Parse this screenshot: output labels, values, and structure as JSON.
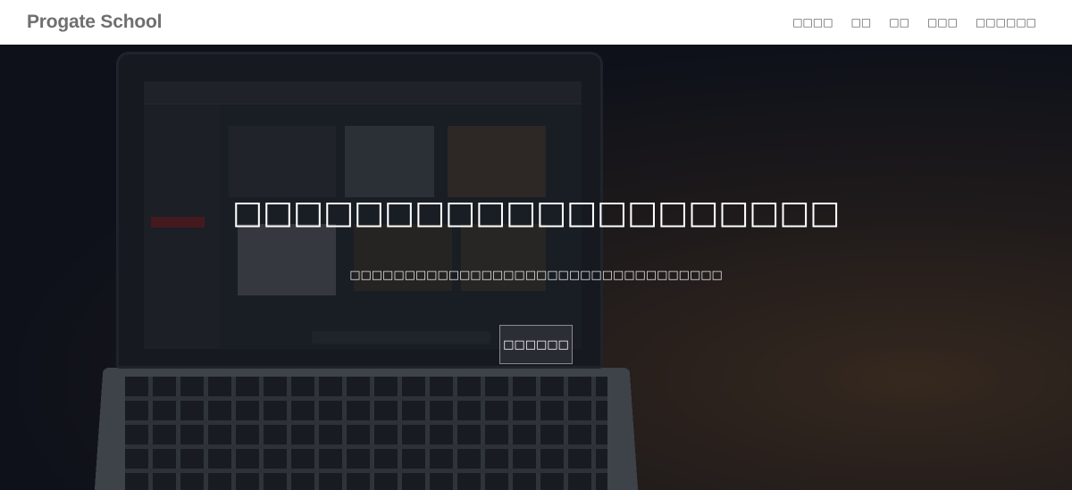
{
  "header": {
    "logo": "Progate School",
    "nav": [
      "□□□□",
      "□□",
      "□□",
      "□□□",
      "□□□□□□"
    ]
  },
  "hero": {
    "title": "□□□□□□□□□□□□□□□□□□□□",
    "subtitle": "□□□□□□□□□□□□□□□□□□□□□□□□□□□□□□□□□□",
    "button_label": "□□□□□□"
  }
}
